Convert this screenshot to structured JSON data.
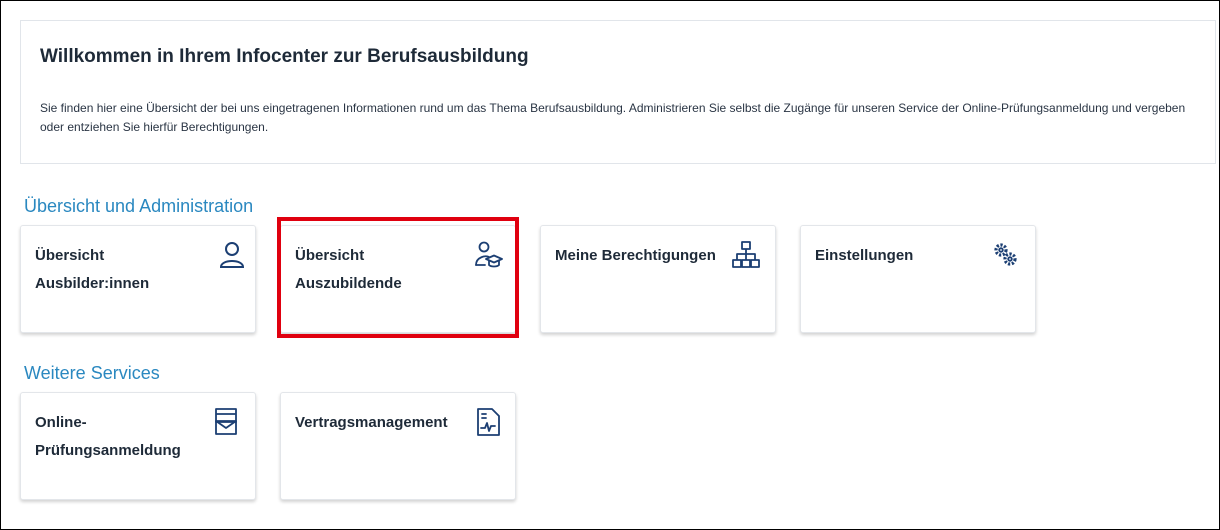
{
  "welcome": {
    "title": "Willkommen in Ihrem Infocenter zur Berufsausbildung",
    "text": "Sie finden hier eine Übersicht der bei uns eingetragenen Informationen rund um das Thema Berufsausbildung. Administrieren Sie selbst die Zugänge für unseren Service der Online-Prüfungsanmeldung und vergeben oder entziehen Sie hierfür Berechtigungen."
  },
  "sections": {
    "overview": {
      "heading": "Übersicht und Administration",
      "tiles": [
        {
          "label": "Übersicht Ausbilder:innen",
          "icon": "person-icon"
        },
        {
          "label": "Übersicht Auszubildende",
          "icon": "trainee-graduate-icon"
        },
        {
          "label": "Meine Berechtigungen",
          "icon": "org-chart-icon"
        },
        {
          "label": "Einstellungen",
          "icon": "gears-icon"
        }
      ]
    },
    "services": {
      "heading": "Weitere Services",
      "tiles": [
        {
          "label": "Online-Prüfungsanmeldung",
          "icon": "mail-form-icon"
        },
        {
          "label": "Vertragsmanagement",
          "icon": "contract-document-icon"
        }
      ]
    }
  },
  "colors": {
    "accent": "#2a88c0",
    "icon": "#1c3f73",
    "highlight": "#e0000f",
    "title": "#1e2a38"
  }
}
